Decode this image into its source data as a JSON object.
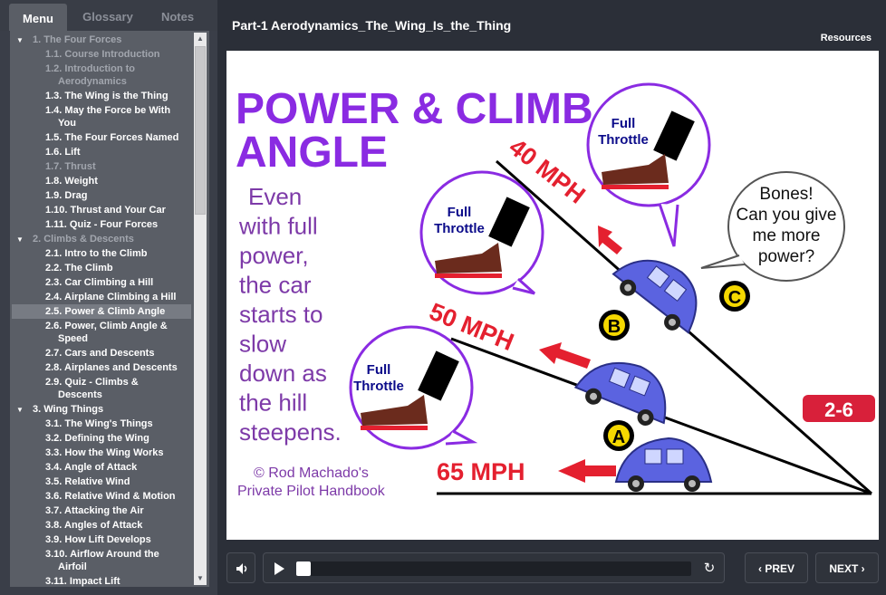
{
  "sidebar": {
    "tabs": [
      "Menu",
      "Glossary",
      "Notes"
    ],
    "items": [
      {
        "label": "1. The Four Forces",
        "section": true,
        "dim": true
      },
      {
        "label": "1.1. Course Introduction",
        "dim": true
      },
      {
        "label": "1.2. Introduction to",
        "label2": "Aerodynamics",
        "dim": true
      },
      {
        "label": "1.3. The Wing is the Thing"
      },
      {
        "label": "1.4. May the Force be With",
        "label2": "You"
      },
      {
        "label": "1.5. The Four Forces Named"
      },
      {
        "label": "1.6. Lift"
      },
      {
        "label": "1.7. Thrust",
        "dim": true
      },
      {
        "label": "1.8. Weight"
      },
      {
        "label": "1.9. Drag"
      },
      {
        "label": "1.10. Thrust and Your Car"
      },
      {
        "label": "1.11. Quiz - Four Forces"
      },
      {
        "label": "2. Climbs & Descents",
        "section": true,
        "dim": true
      },
      {
        "label": "2.1. Intro to the Climb"
      },
      {
        "label": "2.2. The Climb"
      },
      {
        "label": "2.3. Car Climbing a Hill"
      },
      {
        "label": "2.4. Airplane Climbing a Hill"
      },
      {
        "label": "2.5. Power & Climb Angle",
        "selected": true
      },
      {
        "label": "2.6. Power, Climb Angle &",
        "label2": "Speed"
      },
      {
        "label": "2.7. Cars and Descents"
      },
      {
        "label": "2.8. Airplanes and Descents"
      },
      {
        "label": "2.9. Quiz - Climbs &",
        "label2": "Descents"
      },
      {
        "label": "3. Wing Things",
        "section": true
      },
      {
        "label": "3.1. The Wing's Things"
      },
      {
        "label": "3.2. Defining the Wing"
      },
      {
        "label": "3.3. How the Wing Works"
      },
      {
        "label": "3.4. Angle of Attack"
      },
      {
        "label": "3.5. Relative Wind"
      },
      {
        "label": "3.6. Relative Wind & Motion"
      },
      {
        "label": "3.7. Attacking the Air"
      },
      {
        "label": "3.8. Angles of Attack"
      },
      {
        "label": "3.9. How Lift Develops"
      },
      {
        "label": "3.10. Airflow Around the",
        "label2": "Airfoil"
      },
      {
        "label": "3.11. Impact Lift"
      }
    ]
  },
  "header": {
    "title": "Part-1 Aerodynamics_The_Wing_Is_the_Thing",
    "resources": "Resources"
  },
  "slide": {
    "heading1": "POWER & CLIMB",
    "heading2": "ANGLE",
    "body_lines": [
      "Even",
      "with full",
      "power,",
      "the car",
      "starts to",
      "slow",
      "down as",
      "the hill",
      "steepens."
    ],
    "copyright1": "© Rod Machado's",
    "copyright2": "Private Pilot Handbook",
    "speed_a": "65 MPH",
    "speed_b": "50 MPH",
    "speed_c": "40 MPH",
    "label_a": "A",
    "label_b": "B",
    "label_c": "C",
    "throttle1": "Full",
    "throttle2": "Throttle",
    "bubble": [
      "Bones!",
      "Can you give",
      "me more",
      "power?"
    ],
    "page_badge": "2-6",
    "colors": {
      "purple": "#8a2be2",
      "red": "#e4202f",
      "yellow": "#f5d800",
      "car": "#5b63e0"
    }
  },
  "player": {
    "prev": "PREV",
    "next": "NEXT",
    "progress": 0
  }
}
